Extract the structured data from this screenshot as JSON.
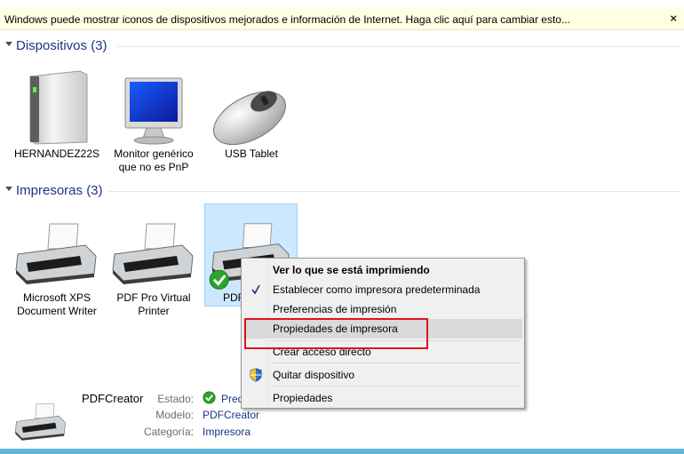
{
  "infobar": {
    "text": "Windows puede mostrar iconos de dispositivos mejorados e información de Internet. Haga clic aquí para cambiar esto...",
    "close_glyph": "×"
  },
  "groups": {
    "devices": {
      "title": "Dispositivos (3)",
      "items": [
        {
          "label_line1": "HERNANDEZ22S",
          "label_line2": "",
          "icon": "computer-tower-icon"
        },
        {
          "label_line1": "Monitor genérico",
          "label_line2": "que no es PnP",
          "icon": "monitor-icon"
        },
        {
          "label_line1": "USB Tablet",
          "label_line2": "",
          "icon": "mouse-icon"
        }
      ]
    },
    "printers": {
      "title": "Impresoras (3)",
      "items": [
        {
          "label_line1": "Microsoft XPS",
          "label_line2": "Document Writer",
          "icon": "printer-icon"
        },
        {
          "label_line1": "PDF Pro Virtual",
          "label_line2": "Printer",
          "icon": "printer-icon"
        },
        {
          "label_line1": "PDF",
          "label_line2": "",
          "icon": "printer-default-icon"
        }
      ]
    }
  },
  "context_menu": {
    "items": [
      {
        "label": "Ver lo que se está imprimiendo",
        "bold": true
      },
      {
        "label": "Establecer como impresora predeterminada",
        "checked": true
      },
      {
        "label": "Preferencias de impresión"
      },
      {
        "label": "Propiedades de impresora",
        "hover": true
      },
      {
        "label": "Crear acceso directo"
      },
      {
        "label": "Quitar dispositivo",
        "icon": "uac-shield-icon"
      },
      {
        "label": "Propiedades"
      }
    ]
  },
  "details": {
    "name": "PDFCreator",
    "estado_key": "Estado:",
    "estado_value": "Pred",
    "modelo_key": "Modelo:",
    "modelo_value": "PDFCreator",
    "categoria_key": "Categoría:",
    "categoria_value": "Impresora"
  },
  "colors": {
    "accent_title": "#1e3287",
    "highlight_border": "#e0121c",
    "selection_fill": "#cce8ff"
  }
}
